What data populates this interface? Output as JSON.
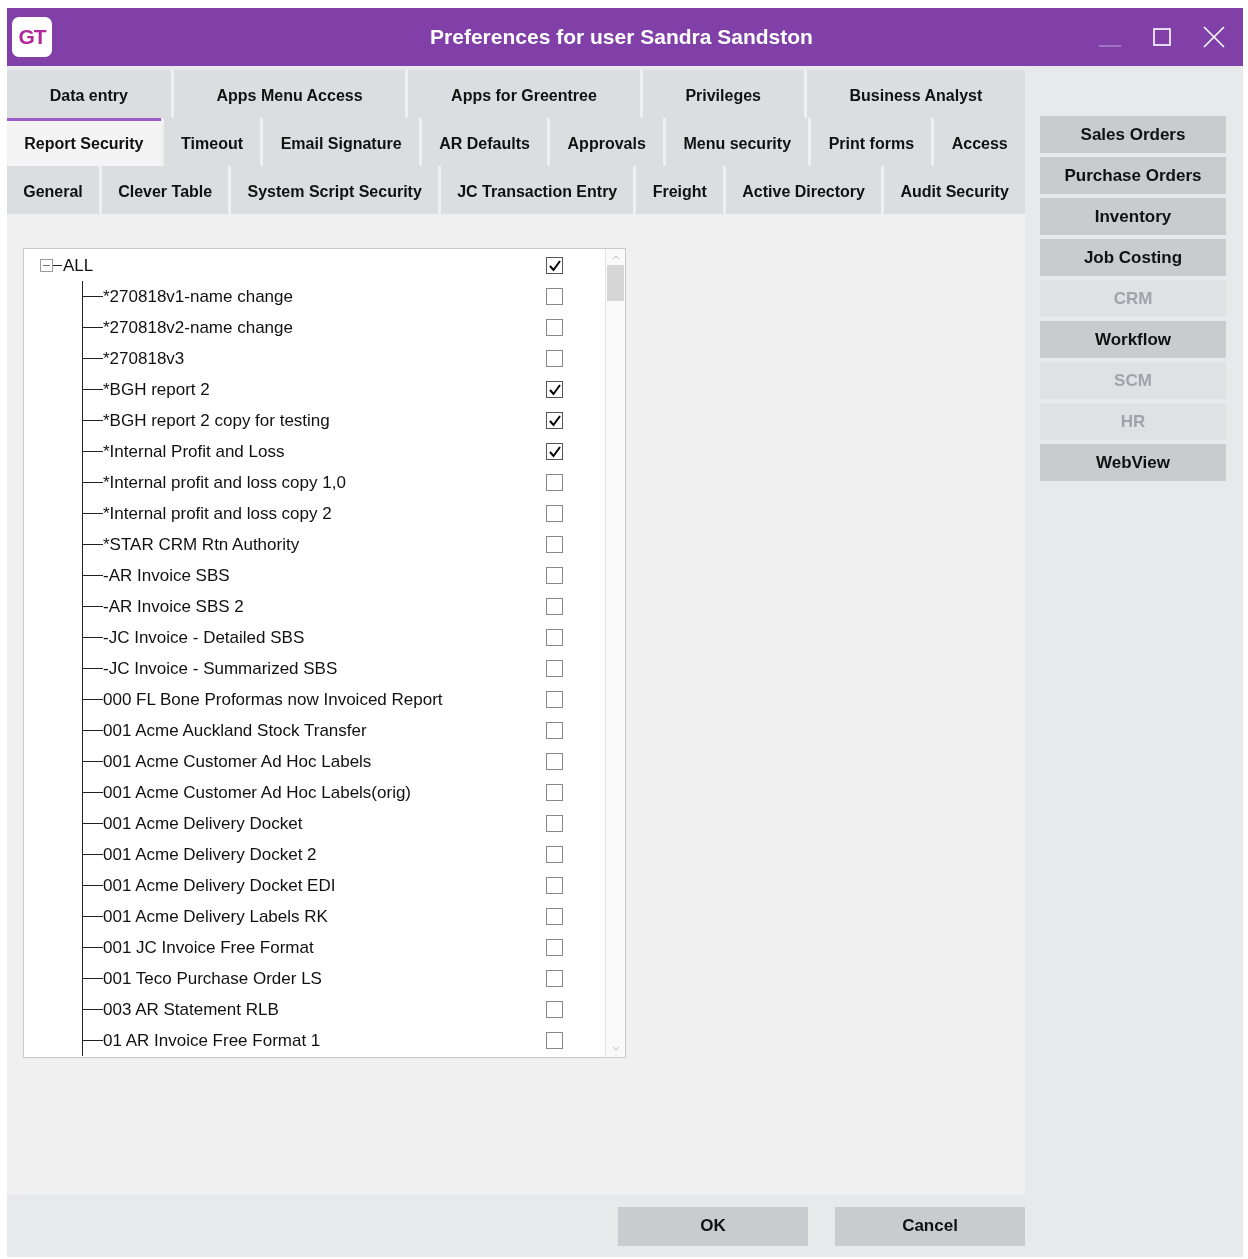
{
  "window": {
    "title": "Preferences for user Sandra Sandston",
    "logo": "GT"
  },
  "tab_rows": [
    [
      {
        "label": "Data entry",
        "selected": false
      },
      {
        "label": "Apps Menu Access",
        "selected": false
      },
      {
        "label": "Apps for Greentree",
        "selected": false
      },
      {
        "label": "Privileges",
        "selected": false
      },
      {
        "label": "Business Analyst",
        "selected": false
      }
    ],
    [
      {
        "label": "Report Security",
        "selected": true
      },
      {
        "label": "Timeout",
        "selected": false
      },
      {
        "label": "Email Signature",
        "selected": false
      },
      {
        "label": "AR Defaults",
        "selected": false
      },
      {
        "label": "Approvals",
        "selected": false
      },
      {
        "label": "Menu security",
        "selected": false
      },
      {
        "label": "Print forms",
        "selected": false
      },
      {
        "label": "Access",
        "selected": false
      }
    ],
    [
      {
        "label": "General",
        "selected": false
      },
      {
        "label": "Clever Table",
        "selected": false
      },
      {
        "label": "System Script Security",
        "selected": false
      },
      {
        "label": "JC Transaction Entry",
        "selected": false
      },
      {
        "label": "Freight",
        "selected": false
      },
      {
        "label": "Active Directory",
        "selected": false
      },
      {
        "label": "Audit Security",
        "selected": false
      }
    ]
  ],
  "tree": {
    "label": "ALL",
    "checked": true,
    "expanded": true,
    "children": [
      {
        "label": "*270818v1-name change",
        "checked": false
      },
      {
        "label": "*270818v2-name change",
        "checked": false
      },
      {
        "label": "*270818v3",
        "checked": false
      },
      {
        "label": "*BGH report 2",
        "checked": true
      },
      {
        "label": "*BGH report 2 copy for testing",
        "checked": true
      },
      {
        "label": "*Internal Profit and Loss",
        "checked": true
      },
      {
        "label": "*Internal profit and loss copy 1,0",
        "checked": false
      },
      {
        "label": "*Internal profit and loss copy 2",
        "checked": false
      },
      {
        "label": "*STAR CRM Rtn Authority",
        "checked": false
      },
      {
        "label": "-AR Invoice SBS",
        "checked": false
      },
      {
        "label": "-AR Invoice SBS 2",
        "checked": false
      },
      {
        "label": "-JC Invoice - Detailed SBS",
        "checked": false
      },
      {
        "label": "-JC Invoice - Summarized SBS",
        "checked": false
      },
      {
        "label": "000 FL Bone Proformas now Invoiced Report",
        "checked": false
      },
      {
        "label": "001 Acme Auckland Stock Transfer",
        "checked": false
      },
      {
        "label": "001 Acme Customer Ad Hoc Labels",
        "checked": false
      },
      {
        "label": "001 Acme Customer Ad Hoc Labels(orig)",
        "checked": false
      },
      {
        "label": "001 Acme Delivery Docket",
        "checked": false
      },
      {
        "label": "001 Acme Delivery Docket 2",
        "checked": false
      },
      {
        "label": "001 Acme Delivery Docket EDI",
        "checked": false
      },
      {
        "label": "001 Acme Delivery Labels RK",
        "checked": false
      },
      {
        "label": "001 JC Invoice Free Format",
        "checked": false
      },
      {
        "label": "001 Teco Purchase Order LS",
        "checked": false
      },
      {
        "label": "003 AR Statement RLB",
        "checked": false
      },
      {
        "label": "01 AR Invoice Free Format 1",
        "checked": false
      }
    ]
  },
  "module_buttons": [
    {
      "label": "Sales Orders",
      "disabled": false
    },
    {
      "label": "Purchase Orders",
      "disabled": false
    },
    {
      "label": "Inventory",
      "disabled": false
    },
    {
      "label": "Job Costing",
      "disabled": false
    },
    {
      "label": "CRM",
      "disabled": true
    },
    {
      "label": "Workflow",
      "disabled": false
    },
    {
      "label": "SCM",
      "disabled": true
    },
    {
      "label": "HR",
      "disabled": true
    },
    {
      "label": "WebView",
      "disabled": false
    }
  ],
  "buttons": [
    "OK",
    "Cancel"
  ]
}
